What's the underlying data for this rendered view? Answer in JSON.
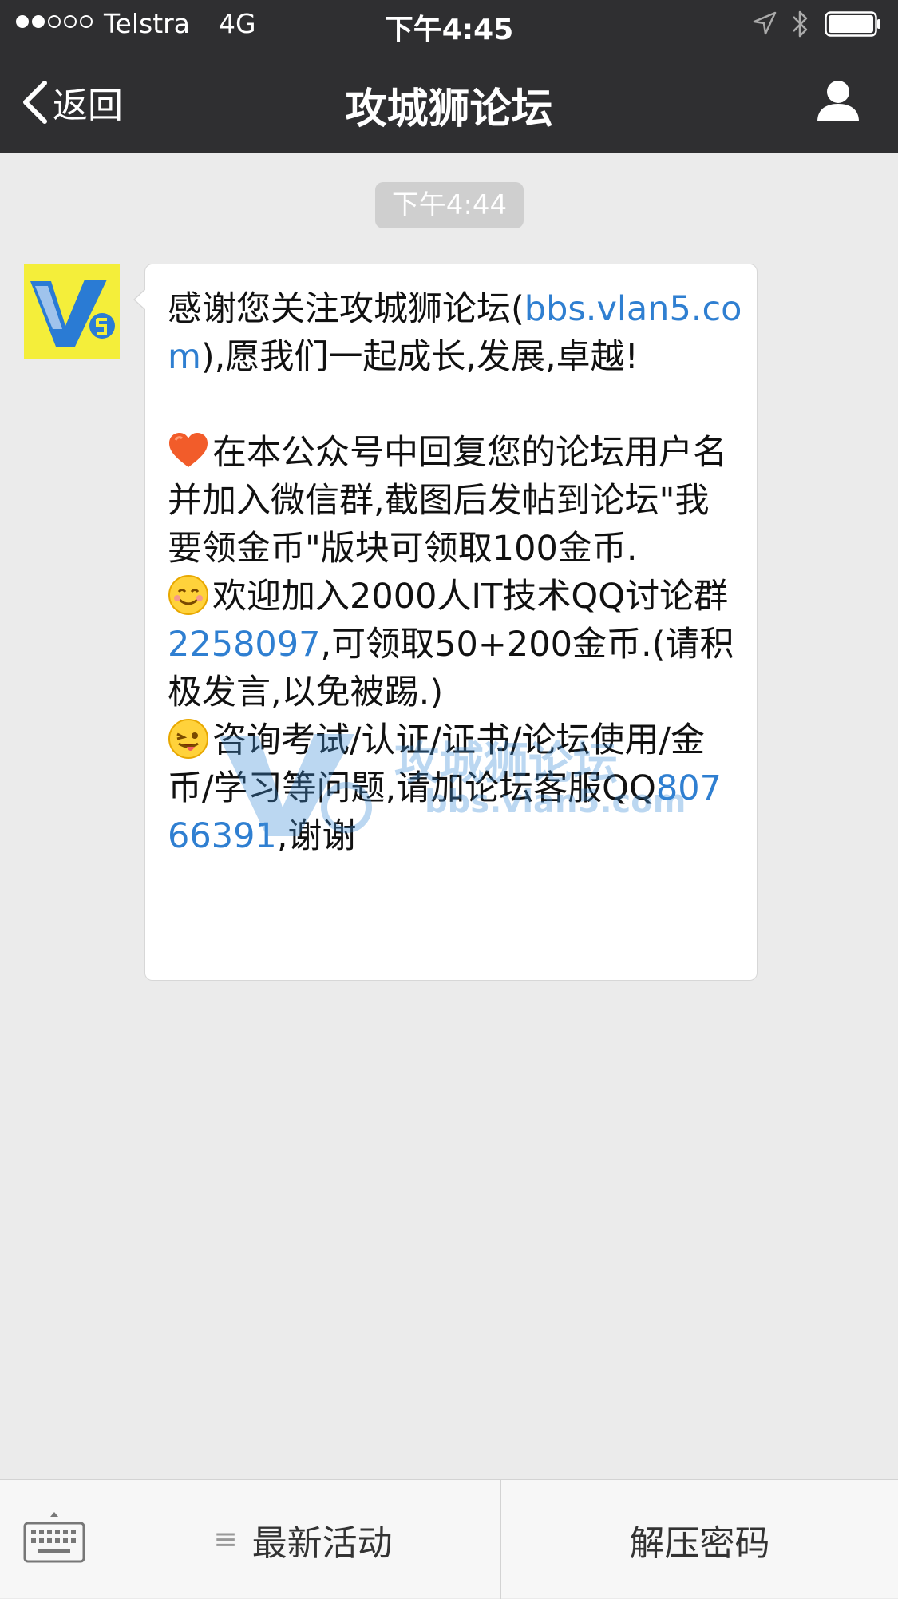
{
  "status_bar": {
    "carrier": "Telstra",
    "network": "4G",
    "time": "下午4:45"
  },
  "nav": {
    "back_label": "返回",
    "title": "攻城狮论坛"
  },
  "chat": {
    "timestamp": "下午4:44",
    "message": {
      "p1_text": "感谢您关注攻城狮论坛(",
      "p1_link": "bbs.vlan5.com",
      "p1_tail": "),愿我们一起成长,发展,卓越!",
      "p2_text": "在本公众号中回复您的论坛用户名并加入微信群,截图后发帖到论坛\"我要领金币\"版块可领取100金币.",
      "p3_text": "欢迎加入2000人IT技术QQ讨论群",
      "p3_link": "2258097",
      "p3_tail": ",可领取50+200金币.(请积极发言,以免被踢.)",
      "p4_text": "咨询考试/认证/证书/论坛使用/金币/学习等问题,请加论坛客服QQ",
      "p4_link": "80766391",
      "p4_tail": ",谢谢"
    },
    "watermark": {
      "title": "攻城狮论坛",
      "subtitle": "bbs.vlan5.com"
    }
  },
  "bottom_menu": {
    "item1": "最新活动",
    "item2": "解压密码"
  },
  "icons": {
    "heart": "heart-icon",
    "smile": "smile-icon",
    "wink": "wink-tongue-icon"
  }
}
